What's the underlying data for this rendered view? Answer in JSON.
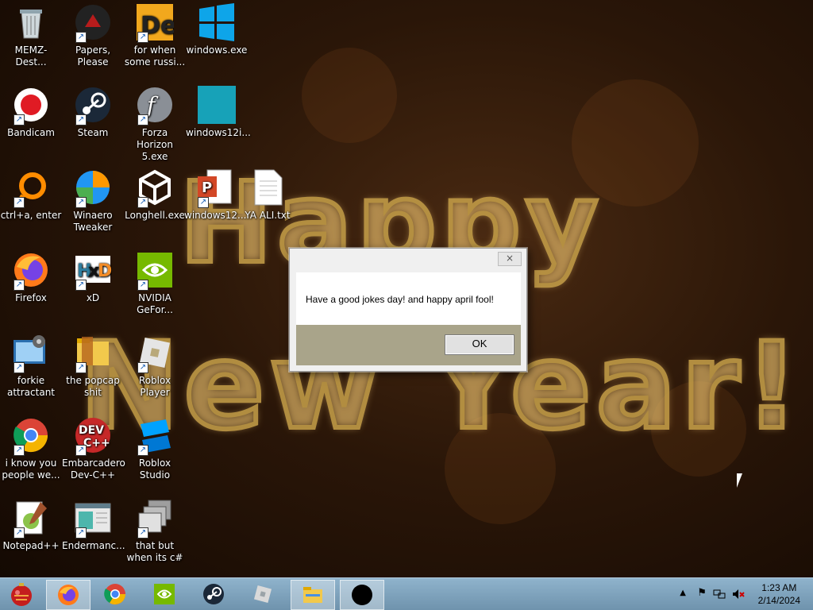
{
  "desktop": {
    "icons": [
      {
        "label": "MEMZ-Dest...",
        "icon": "recycle-bin-icon"
      },
      {
        "label": "Papers, Please",
        "icon": "papers-please-icon"
      },
      {
        "label": "for when some russi...",
        "icon": "de-app-icon"
      },
      {
        "label": "windows.exe",
        "icon": "windows-logo-icon"
      },
      {
        "label": "Bandicam",
        "icon": "bandicam-icon"
      },
      {
        "label": "Steam",
        "icon": "steam-icon"
      },
      {
        "label": "Forza Horizon 5.exe",
        "icon": "flash-icon"
      },
      {
        "label": "windows12i...",
        "icon": "teal-image-icon"
      },
      {
        "label": "ctrl+a, enter",
        "icon": "orange-ring-icon"
      },
      {
        "label": "Winaero Tweaker",
        "icon": "winaero-icon"
      },
      {
        "label": "Longhell.exe",
        "icon": "unity-icon"
      },
      {
        "label": "windows12...",
        "icon": "powerpoint-icon"
      },
      {
        "label": "YA ALI.txt",
        "icon": "text-file-icon"
      },
      {
        "label": "Firefox",
        "icon": "firefox-icon"
      },
      {
        "label": "xD",
        "icon": "hxd-icon"
      },
      {
        "label": "NVIDIA GeFor...",
        "icon": "nvidia-icon"
      },
      {
        "label": "forkie attractant",
        "icon": "control-panel-icon"
      },
      {
        "label": "the popcap shit",
        "icon": "folder-icon"
      },
      {
        "label": "Roblox Player",
        "icon": "roblox-player-icon"
      },
      {
        "label": "i know you people we...",
        "icon": "chrome-icon"
      },
      {
        "label": "Embarcadero Dev-C++",
        "icon": "devcpp-icon"
      },
      {
        "label": "Roblox Studio",
        "icon": "roblox-studio-icon"
      },
      {
        "label": "Notepad++",
        "icon": "notepadpp-icon"
      },
      {
        "label": "Endermanc...",
        "icon": "window-app-icon"
      },
      {
        "label": "that but when its c#",
        "icon": "stacked-windows-icon"
      }
    ]
  },
  "dialog": {
    "message": "Have a good jokes day! and happy april fool!",
    "ok_label": "OK",
    "close_glyph": "×"
  },
  "taskbar": {
    "items": [
      "ornament-start-icon",
      "firefox-icon",
      "chrome-icon",
      "nvidia-icon",
      "steam-icon",
      "roblox-icon",
      "file-explorer-icon",
      "black-circle-icon"
    ],
    "clock_time": "1:23 AM",
    "clock_date": "2/14/2024"
  },
  "colors": {
    "accent_taskbar": "#7fa3bd",
    "dialog_footer": "#a9a48a"
  }
}
